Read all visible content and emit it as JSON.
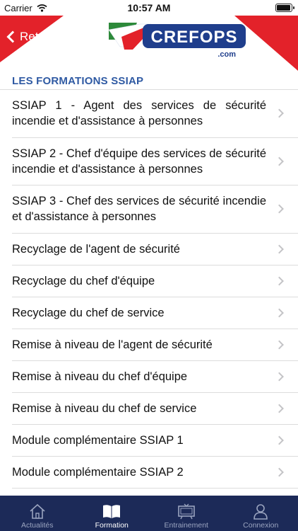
{
  "status": {
    "carrier": "Carrier",
    "time": "10:57 AM"
  },
  "header": {
    "back_label": "Retour",
    "logo_text": "CREFOPS",
    "logo_sub": ".com"
  },
  "section": {
    "title": "LES FORMATIONS SSIAP"
  },
  "items": [
    {
      "label": "SSIAP 1 - Agent des services de sécurité incendie et d'assistance à personnes"
    },
    {
      "label": "SSIAP 2 - Chef d'équipe des services de sécurité incendie et d'assistance à personnes"
    },
    {
      "label": "SSIAP 3 - Chef des services de sécurité incendie et d'assistance à personnes"
    },
    {
      "label": "Recyclage de l'agent de sécurité"
    },
    {
      "label": "Recyclage du chef d'équipe"
    },
    {
      "label": "Recyclage du chef de service"
    },
    {
      "label": "Remise à niveau de l'agent de sécurité"
    },
    {
      "label": "Remise à niveau du chef d'équipe"
    },
    {
      "label": "Remise à niveau du chef de service"
    },
    {
      "label": "Module complémentaire SSIAP 1"
    },
    {
      "label": "Module complémentaire SSIAP 2"
    }
  ],
  "tabs": [
    {
      "label": "Actualités",
      "icon": "house-icon",
      "active": false
    },
    {
      "label": "Formation",
      "icon": "book-icon",
      "active": true
    },
    {
      "label": "Entrainement",
      "icon": "board-icon",
      "active": false
    },
    {
      "label": "Connexion",
      "icon": "person-icon",
      "active": false
    }
  ],
  "colors": {
    "accent_red": "#e3222a",
    "logo_blue": "#1f3e8c",
    "section_title": "#2f5aa3",
    "tab_bar": "#1c2a58"
  }
}
